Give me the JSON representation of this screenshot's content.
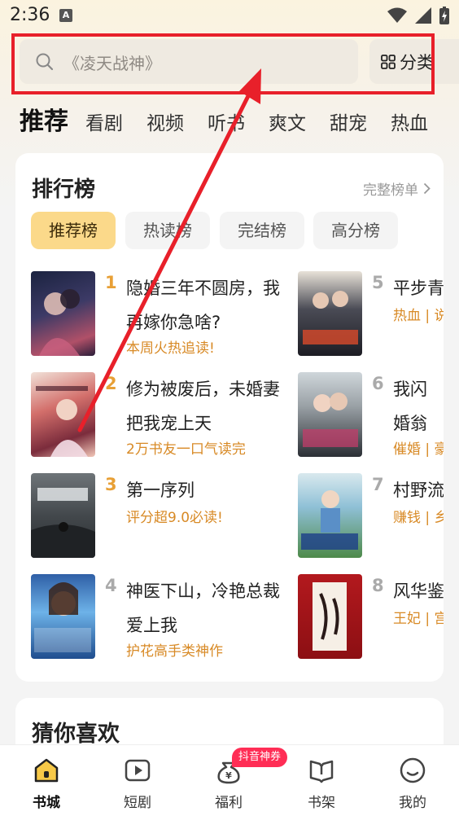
{
  "status_bar": {
    "time": "2:36",
    "notification_letter": "A"
  },
  "search": {
    "placeholder": "《凌天战神》",
    "category_label": "分类"
  },
  "tabs": [
    "推荐",
    "看剧",
    "视频",
    "听书",
    "爽文",
    "甜宠",
    "热血"
  ],
  "ranking": {
    "title": "排行榜",
    "more_label": "完整榜单",
    "tabs": [
      "推荐榜",
      "热读榜",
      "完结榜",
      "高分榜"
    ],
    "books": [
      {
        "rank": "1",
        "title": "隐婚三年不圆房，我再嫁你急啥?",
        "tag": "本周火热追读!"
      },
      {
        "rank": "2",
        "title": "修为被废后，未婚妻把我宠上天",
        "tag": "2万书友一口气读完"
      },
      {
        "rank": "3",
        "title": "第一序列",
        "tag": "评分超9.0必读!"
      },
      {
        "rank": "4",
        "title": "神医下山，冷艳总裁爱上我",
        "tag": "护花高手类神作"
      },
      {
        "rank": "5",
        "title": "平步青",
        "tag": "热血 | 说"
      },
      {
        "rank": "6",
        "title": "我闪婚翁",
        "tag": "催婚 | 豪"
      },
      {
        "rank": "7",
        "title": "村野流",
        "tag": "赚钱 | 乡"
      },
      {
        "rank": "8",
        "title": "风华鉴",
        "tag": "王妃 | 宫"
      }
    ]
  },
  "guess": {
    "title": "猜你喜欢"
  },
  "nav": {
    "items": [
      "书城",
      "短剧",
      "福利",
      "书架",
      "我的"
    ],
    "promo_badge": "抖音神券"
  },
  "colors": {
    "accent": "#d88a26",
    "active_tab": "#fbd98a",
    "annotation_red": "#e8202a",
    "badge": "#ff2d55"
  }
}
